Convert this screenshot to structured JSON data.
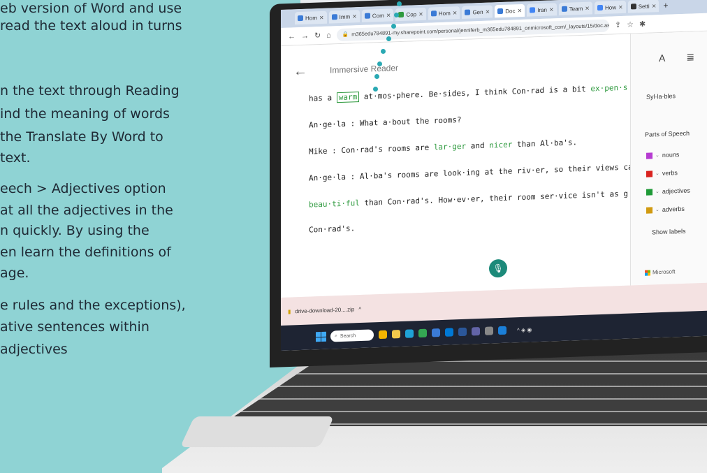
{
  "slide": {
    "lines": [
      "eb version of Word and use",
      " read the text aloud in turns",
      "n the text through Reading",
      "ind the meaning of words",
      "the Translate By Word to",
      "text.",
      "eech > Adjectives option",
      "at all the adjectives in the",
      "n quickly. By using the",
      "en learn the definitions of",
      "age.",
      "e rules and the exceptions),",
      "ative sentences within",
      "adjectives"
    ]
  },
  "browser": {
    "tabs": [
      "Hom",
      "Imm",
      "Com",
      "Cop",
      "Hom",
      "Gen",
      "Doc",
      "Iran",
      "Team",
      "How",
      "Setti"
    ],
    "new_tab": "+",
    "url": "m365edu784891-my.sharepoint.com/personal/jenniferb_m365edu784891_onmicrosoft_com/_layouts/15/doc.aspx?source..."
  },
  "reader": {
    "title": "Immersive Reader",
    "lines": [
      {
        "pre": "has a ",
        "hl": "warm",
        "mid": " at·mos·phere. Be·sides, I think Con·rad is a bit ",
        "adj": "ex·pen·s",
        "post": ""
      },
      {
        "pre": "An·ge·la : What a·bout the rooms?",
        "hl": "",
        "mid": "",
        "adj": "",
        "post": ""
      },
      {
        "pre": "Mike : Con·rad's rooms are ",
        "hl": "",
        "mid": "",
        "adj": "lar·ger",
        "post": " and ",
        "adj2": "nicer",
        "post2": " than Al·ba's."
      },
      {
        "pre": "An·ge·la : Al·ba's rooms are look·ing at the riv·er, so their views ca",
        "hl": "",
        "mid": "",
        "adj": "",
        "post": ""
      },
      {
        "pre": "",
        "hl": "",
        "mid": "",
        "adj": "beau·ti·ful",
        "post": " than Con·rad's. How·ev·er, their room ser·vice isn't as g"
      },
      {
        "pre": "Con·rad's.",
        "hl": "",
        "mid": "",
        "adj": "",
        "post": ""
      }
    ]
  },
  "options": {
    "text_prefs_icon": "A",
    "syllables": "Syl·la·bles",
    "parts_heading": "Parts of Speech",
    "parts": [
      {
        "label": "nouns",
        "color": "#b63bd1"
      },
      {
        "label": "verbs",
        "color": "#d9231f"
      },
      {
        "label": "adjectives",
        "color": "#1f9a37"
      },
      {
        "label": "adverbs",
        "color": "#d19a10"
      }
    ],
    "show_labels": "Show labels",
    "brand": "Microsoft"
  },
  "download": {
    "file": "drive-download-20....zip",
    "chevron": "^"
  },
  "taskbar": {
    "search": "Search"
  }
}
